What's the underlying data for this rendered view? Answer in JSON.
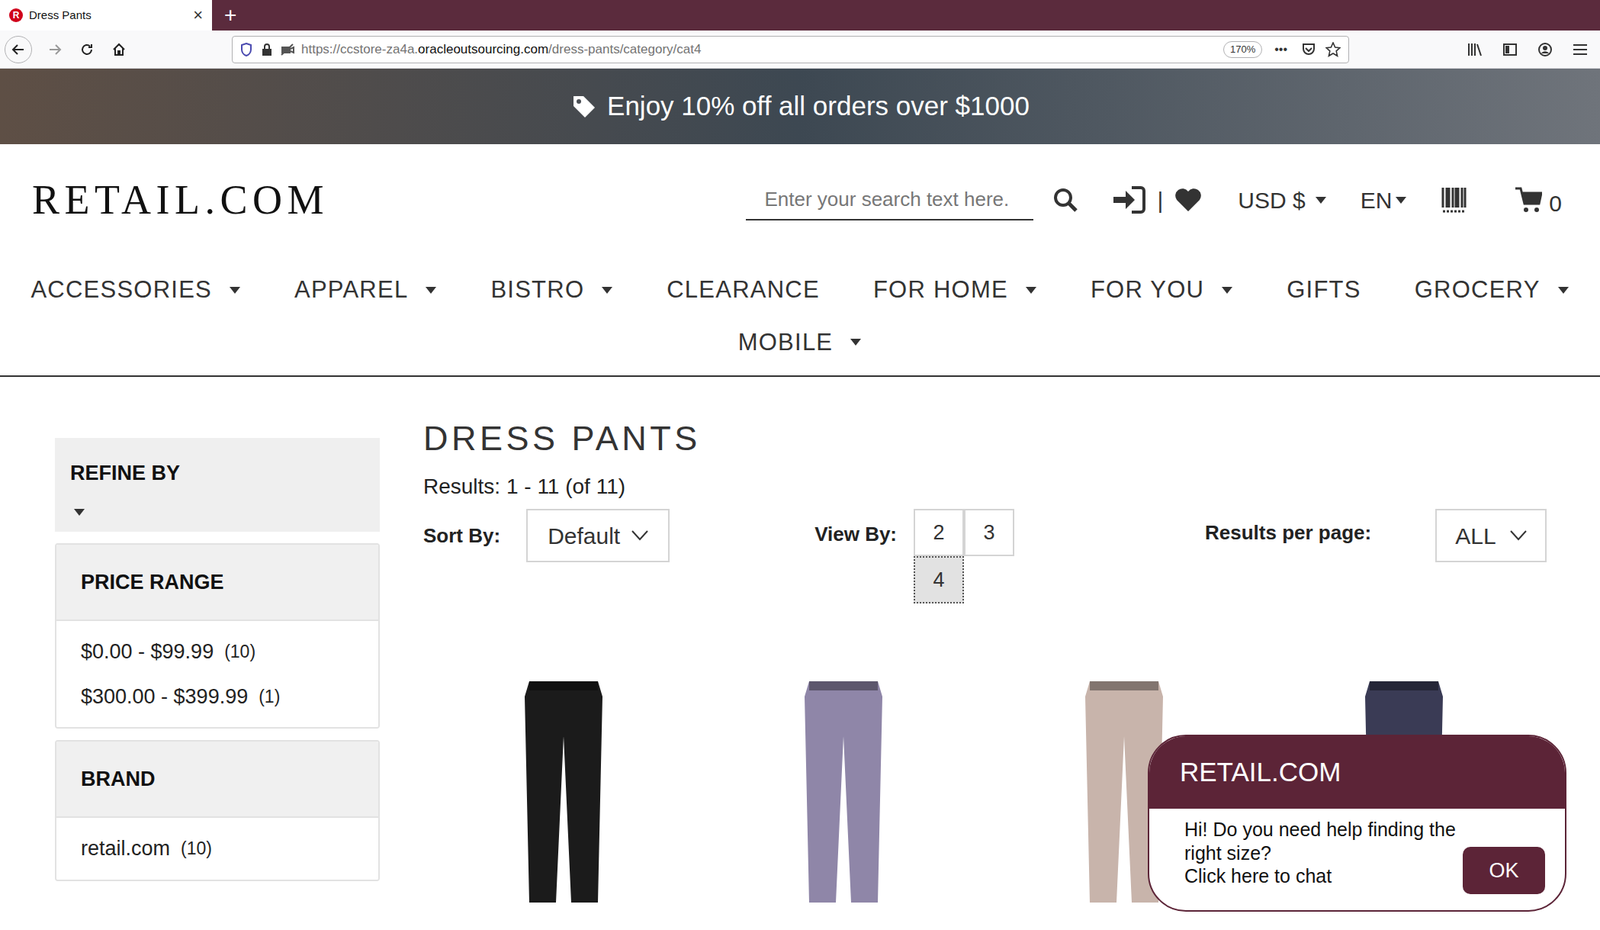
{
  "browser": {
    "tab": {
      "favicon": "R",
      "title": "Dress Pants",
      "close": "×"
    },
    "new_tab": "+",
    "url": {
      "prefix": "https://ccstore-za4a.",
      "domain": "oracleoutsourcing.com",
      "path": "/dress-pants/category/cat4"
    },
    "zoom": "170%",
    "more": "•••"
  },
  "banner": {
    "text": "Enjoy 10% off all orders over $1000"
  },
  "header": {
    "logo": "RETAIL.COM",
    "search": {
      "placeholder": "Enter your search text here."
    },
    "separator": "|",
    "currency": "USD $",
    "language": "EN",
    "cart_count": "0"
  },
  "nav": [
    {
      "label": "ACCESSORIES",
      "dropdown": true
    },
    {
      "label": "APPAREL",
      "dropdown": true
    },
    {
      "label": "BISTRO",
      "dropdown": true
    },
    {
      "label": "CLEARANCE",
      "dropdown": false
    },
    {
      "label": "FOR HOME",
      "dropdown": true
    },
    {
      "label": "FOR YOU",
      "dropdown": true
    },
    {
      "label": "GIFTS",
      "dropdown": false
    },
    {
      "label": "GROCERY",
      "dropdown": true
    },
    {
      "label": "MOBILE",
      "dropdown": true
    }
  ],
  "sidebar": {
    "title": "REFINE BY",
    "facets": [
      {
        "title": "PRICE RANGE",
        "options": [
          {
            "label": "$0.00 - $99.99",
            "count": "(10)"
          },
          {
            "label": "$300.00 - $399.99",
            "count": "(1)"
          }
        ]
      },
      {
        "title": "BRAND",
        "options": [
          {
            "label": "retail.com",
            "count": "(10)"
          }
        ]
      }
    ]
  },
  "main": {
    "title": "DRESS PANTS",
    "results": "Results: 1 - 11 (of 11)",
    "sort": {
      "label": "Sort By:",
      "value": "Default"
    },
    "view_by": {
      "label": "View By:",
      "options": [
        {
          "label": "2",
          "selected": false
        },
        {
          "label": "3",
          "selected": false
        },
        {
          "label": "4",
          "selected": true
        }
      ]
    },
    "per_page": {
      "label": "Results per page:",
      "value": "ALL"
    }
  },
  "products": [
    {
      "color": "#1b1b1b"
    },
    {
      "color": "#8f86a8"
    },
    {
      "color": "#c8b4ab"
    },
    {
      "color": "#3a3b55"
    }
  ],
  "chat": {
    "title": "RETAIL.COM",
    "message": [
      "Hi! Do you need help finding the",
      "right size?",
      "Click here to chat"
    ],
    "button": "OK"
  }
}
